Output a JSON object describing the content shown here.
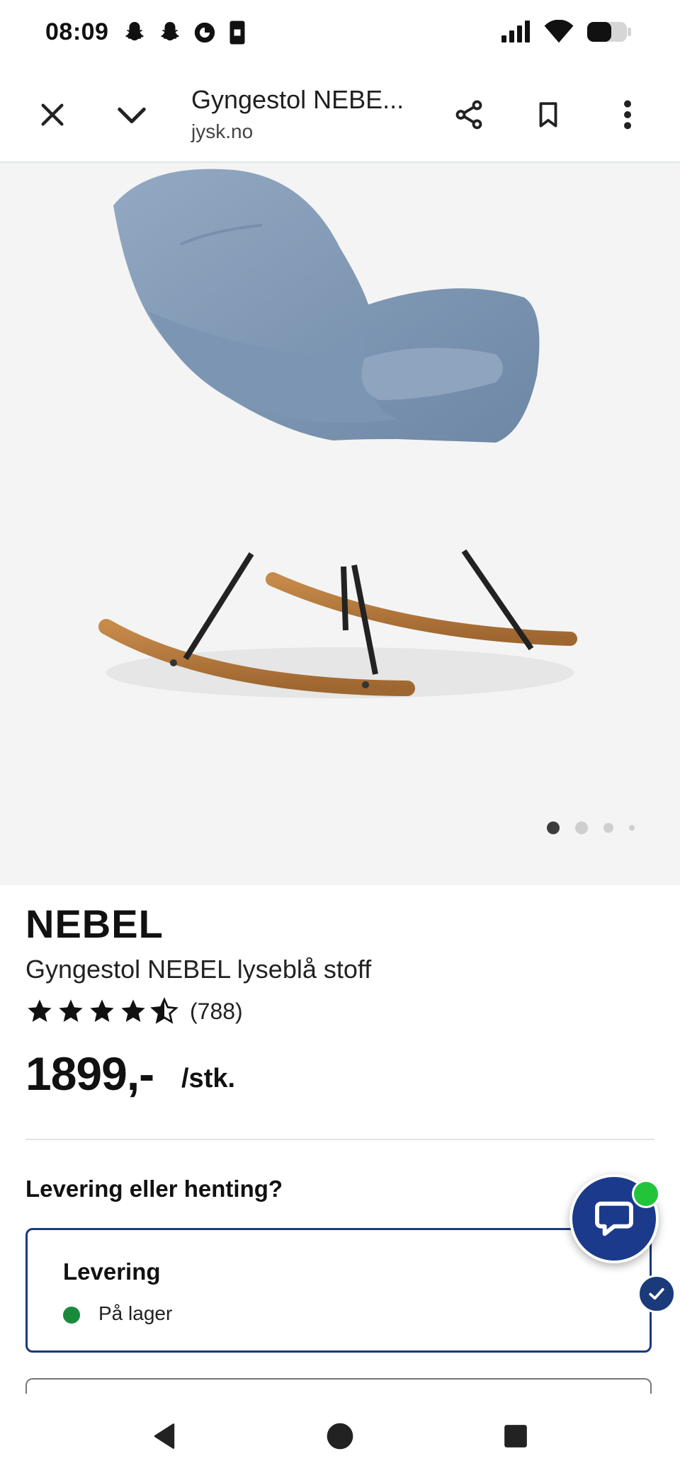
{
  "status_bar": {
    "time": "08:09",
    "left_icons": [
      "snapchat-icon",
      "snapchat-icon",
      "moon-icon",
      "phone-icon"
    ],
    "right_icons": [
      "signal-icon",
      "wifi-icon",
      "battery-icon"
    ]
  },
  "browser": {
    "title": "Gyngestol NEBE...",
    "url": "jysk.no",
    "icons": [
      "close-icon",
      "chevron-down-icon",
      "share-icon",
      "bookmark-icon",
      "more-vert-icon"
    ]
  },
  "gallery": {
    "slide_count": 4,
    "active_index": 0
  },
  "product": {
    "brand": "NEBEL",
    "name": "Gyngestol NEBEL lyseblå stoff",
    "rating": 4.5,
    "rating_count": "(788)",
    "price": "1899,-",
    "unit": "/stk."
  },
  "delivery": {
    "question": "Levering eller henting?",
    "option_title": "Levering",
    "stock_text": "På lager",
    "stock_color": "#1a8a3c",
    "selected": true
  },
  "colors": {
    "accent": "#1b3a7a",
    "chat": "#1b3a8c",
    "online": "#23c43a"
  }
}
